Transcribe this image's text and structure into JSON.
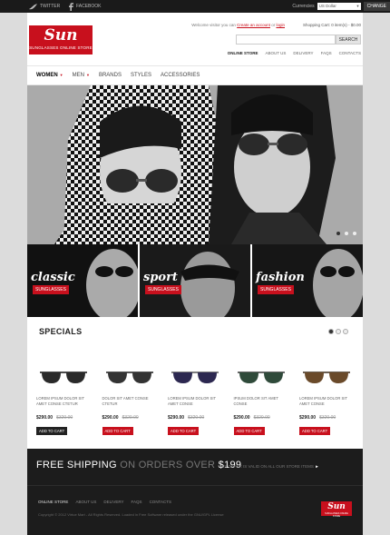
{
  "topbar": {
    "twitter": "TWITTER",
    "facebook": "FACEBOOK",
    "currencies_label": "Currencies",
    "currency_value": "US Dollar",
    "change_button": "CHANGE"
  },
  "logo": {
    "name": "Sun",
    "tagline": "SUNGLASSES ONLINE STORE"
  },
  "header": {
    "welcome_prefix": "Welcome visitor you can",
    "create_account": "Create an account",
    "or": "or",
    "login": "login",
    "cart": "Shopping Cart: 0 item(s) - $0.00",
    "search_placeholder": "",
    "search_button": "SEARCH",
    "links": [
      "ONLINE STORE",
      "ABOUT US",
      "DELIVERY",
      "FAQS",
      "CONTACTS"
    ]
  },
  "nav": {
    "items": [
      "Women",
      "Men",
      "Brands",
      "Styles",
      "Accessories"
    ]
  },
  "banners": [
    {
      "title": "classic",
      "subtitle": "SUNGLASSES"
    },
    {
      "title": "sport",
      "subtitle": "SUNGLASSES"
    },
    {
      "title": "fashion",
      "subtitle": "SUNGLASSES"
    }
  ],
  "specials": {
    "title": "SPECIALS"
  },
  "products": [
    {
      "name": "LOREM IPSUM DOLOR SIT AMET CONSE CTETUR",
      "price": "$290.00",
      "old_price": "$320.00",
      "button": "ADD TO CART",
      "lens": "#2a2a2a",
      "frame": "#111111",
      "btn": "#222222"
    },
    {
      "name": "DOLOR SIT AMET CONSE CTETUR",
      "price": "$290.00",
      "old_price": "$320.00",
      "button": "ADD TO CART",
      "lens": "#333333",
      "frame": "#1a1a1a",
      "btn": "#c8101d"
    },
    {
      "name": "LOREM IPSUM DOLOR SIT AMET CONSE",
      "price": "$290.00",
      "old_price": "$320.00",
      "button": "ADD TO CART",
      "lens": "#2c2850",
      "frame": "#555555",
      "btn": "#c8101d"
    },
    {
      "name": "IPSUM DOLOR SIT AMET CONSE",
      "price": "$290.00",
      "old_price": "$320.00",
      "button": "ADD TO CART",
      "lens": "#2f4a3a",
      "frame": "#333333",
      "btn": "#c8101d"
    },
    {
      "name": "LOREM IPSUM DOLOR SIT AMET CONSE",
      "price": "$290.00",
      "old_price": "$320.00",
      "button": "ADD TO CART",
      "lens": "#6a4a2a",
      "frame": "#3a2a1a",
      "btn": "#c8101d"
    }
  ],
  "footer": {
    "ship_a": "FREE SHIPPING",
    "ship_b": "ON ORDERS OVER",
    "ship_c": "$199",
    "ship_note": "THIS OFFER IS VALID ON ALL OUR STORE ITEMS",
    "links": [
      "ONLINE STORE",
      "ABOUT US",
      "DELIVERY",
      "FAQS",
      "CONTACTS"
    ],
    "copyright": "Copyright © 2012 Virtue Mart - All Rights Reserved. Loaded in Free Software released under the GNU/GPL License",
    "logo_name": "Sun",
    "logo_tagline": "SUNGLASSES ONLINE STORE"
  },
  "colors": {
    "brand": "#c8101d",
    "dark": "#1c1c1c"
  }
}
